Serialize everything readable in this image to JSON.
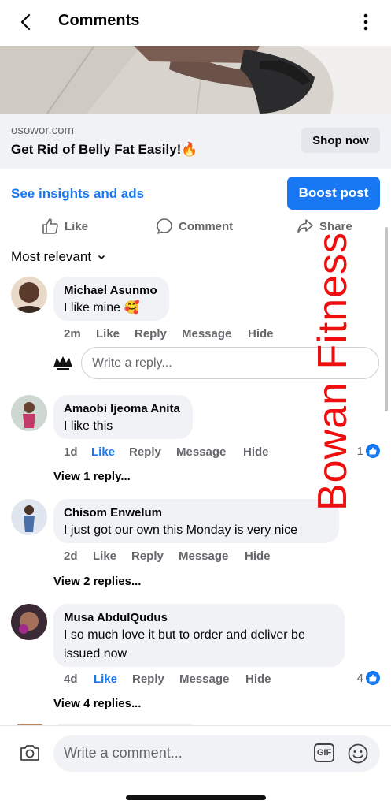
{
  "header": {
    "title": "Comments"
  },
  "ad": {
    "domain": "osowor.com",
    "headline": "Get Rid of Belly Fat Easily!🔥",
    "cta": "Shop now"
  },
  "post_actions": {
    "insights": "See insights and ads",
    "boost": "Boost post",
    "like": "Like",
    "comment": "Comment",
    "share": "Share"
  },
  "sort": {
    "label": "Most relevant"
  },
  "comments": [
    {
      "name": "Michael Asunmo",
      "text": "I like mine 🥰",
      "time": "2m",
      "like": "Like",
      "reply": "Reply",
      "message": "Message",
      "hide": "Hide"
    },
    {
      "name": "Amaobi Ijeoma Anita",
      "text": "I like this",
      "time": "1d",
      "like": "Like",
      "reply": "Reply",
      "message": "Message",
      "hide": "Hide",
      "likes": "1",
      "view_replies": "View 1 reply..."
    },
    {
      "name": "Chisom Enwelum",
      "text": "I  just got our own this Monday is very nice",
      "time": "2d",
      "like": "Like",
      "reply": "Reply",
      "message": "Message",
      "hide": "Hide",
      "view_replies": "View 2 replies..."
    },
    {
      "name": "Musa AbdulQudus",
      "text": "I so much love it but to order and deliver be issued now",
      "time": "4d",
      "like": "Like",
      "reply": "Reply",
      "message": "Message",
      "hide": "Hide",
      "likes": "4",
      "view_replies": "View 4 replies..."
    }
  ],
  "reply_input": {
    "placeholder": "Write a reply..."
  },
  "composer": {
    "placeholder": "Write a comment...",
    "gif": "GIF"
  },
  "watermark": "Bowan Fitness",
  "colors": {
    "accent": "#1877f2",
    "bubble": "#f0f2f5",
    "muted": "#65676b",
    "watermark": "#ef0e0e"
  }
}
